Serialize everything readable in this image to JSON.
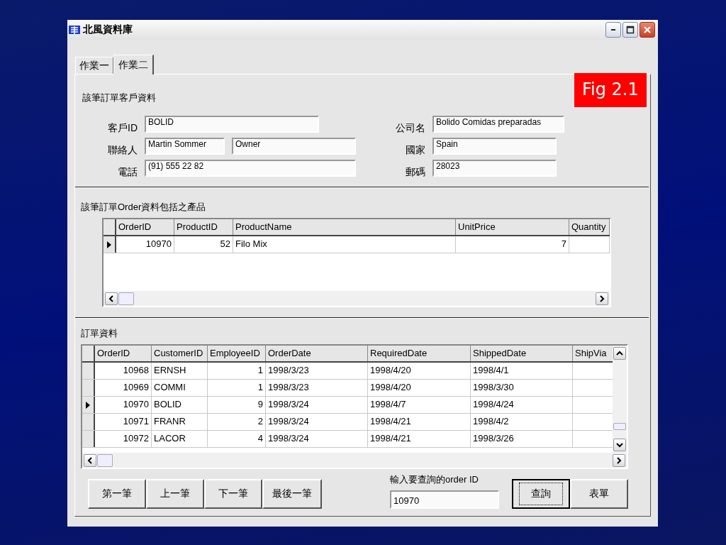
{
  "window": {
    "title": "北風資料庫"
  },
  "figure_label": "Fig 2.1",
  "tabs": [
    {
      "label": "作業一",
      "selected": false
    },
    {
      "label": "作業二",
      "selected": true
    }
  ],
  "customer": {
    "heading": "該筆訂單客戶資料",
    "left": [
      {
        "label": "客戶ID",
        "values": [
          "BOLID"
        ]
      },
      {
        "label": "聯絡人",
        "values": [
          "Martin Sommer",
          "Owner"
        ]
      },
      {
        "label": "電話",
        "values": [
          "(91) 555 22 82"
        ]
      }
    ],
    "right": [
      {
        "label": "公司名",
        "values": [
          "Bolido Comidas preparadas"
        ]
      },
      {
        "label": "國家",
        "values": [
          "Spain"
        ]
      },
      {
        "label": "郵碼",
        "values": [
          "28023"
        ]
      }
    ]
  },
  "products": {
    "heading": "該筆訂單Order資料包括之產品",
    "columns": [
      {
        "label": "OrderID",
        "kind": "number"
      },
      {
        "label": "ProductID",
        "kind": "number"
      },
      {
        "label": "ProductName",
        "kind": "text"
      },
      {
        "label": "UnitPrice",
        "kind": "number"
      },
      {
        "label": "Quantity",
        "kind": "number"
      }
    ],
    "rows": [
      {
        "selected": true,
        "cells": [
          "10970",
          "52",
          "Filo Mix",
          "7",
          ""
        ]
      }
    ]
  },
  "orders": {
    "heading": "訂單資料",
    "columns": [
      {
        "label": "OrderID",
        "kind": "number"
      },
      {
        "label": "CustomerID",
        "kind": "text"
      },
      {
        "label": "EmployeeID",
        "kind": "number"
      },
      {
        "label": "OrderDate",
        "kind": "text"
      },
      {
        "label": "RequiredDate",
        "kind": "text"
      },
      {
        "label": "ShippedDate",
        "kind": "text"
      },
      {
        "label": "ShipVia",
        "kind": "text"
      }
    ],
    "rows": [
      {
        "selected": false,
        "cells": [
          "10968",
          "ERNSH",
          "1",
          "1998/3/23",
          "1998/4/20",
          "1998/4/1",
          ""
        ]
      },
      {
        "selected": false,
        "cells": [
          "10969",
          "COMMI",
          "1",
          "1998/3/23",
          "1998/4/20",
          "1998/3/30",
          ""
        ]
      },
      {
        "selected": true,
        "cells": [
          "10970",
          "BOLID",
          "9",
          "1998/3/24",
          "1998/4/7",
          "1998/4/24",
          ""
        ]
      },
      {
        "selected": false,
        "cells": [
          "10971",
          "FRANR",
          "2",
          "1998/3/24",
          "1998/4/21",
          "1998/4/2",
          ""
        ]
      },
      {
        "selected": false,
        "cells": [
          "10972",
          "LACOR",
          "4",
          "1998/3/24",
          "1998/4/21",
          "1998/3/26",
          ""
        ]
      }
    ]
  },
  "nav_buttons": [
    "第一筆",
    "上一筆",
    "下一筆",
    "最後一筆"
  ],
  "search": {
    "label": "輸入要查詢的order ID",
    "value": "10970"
  },
  "action_buttons": [
    {
      "label": "查詢",
      "focused": true
    },
    {
      "label": "表單",
      "focused": false
    }
  ]
}
